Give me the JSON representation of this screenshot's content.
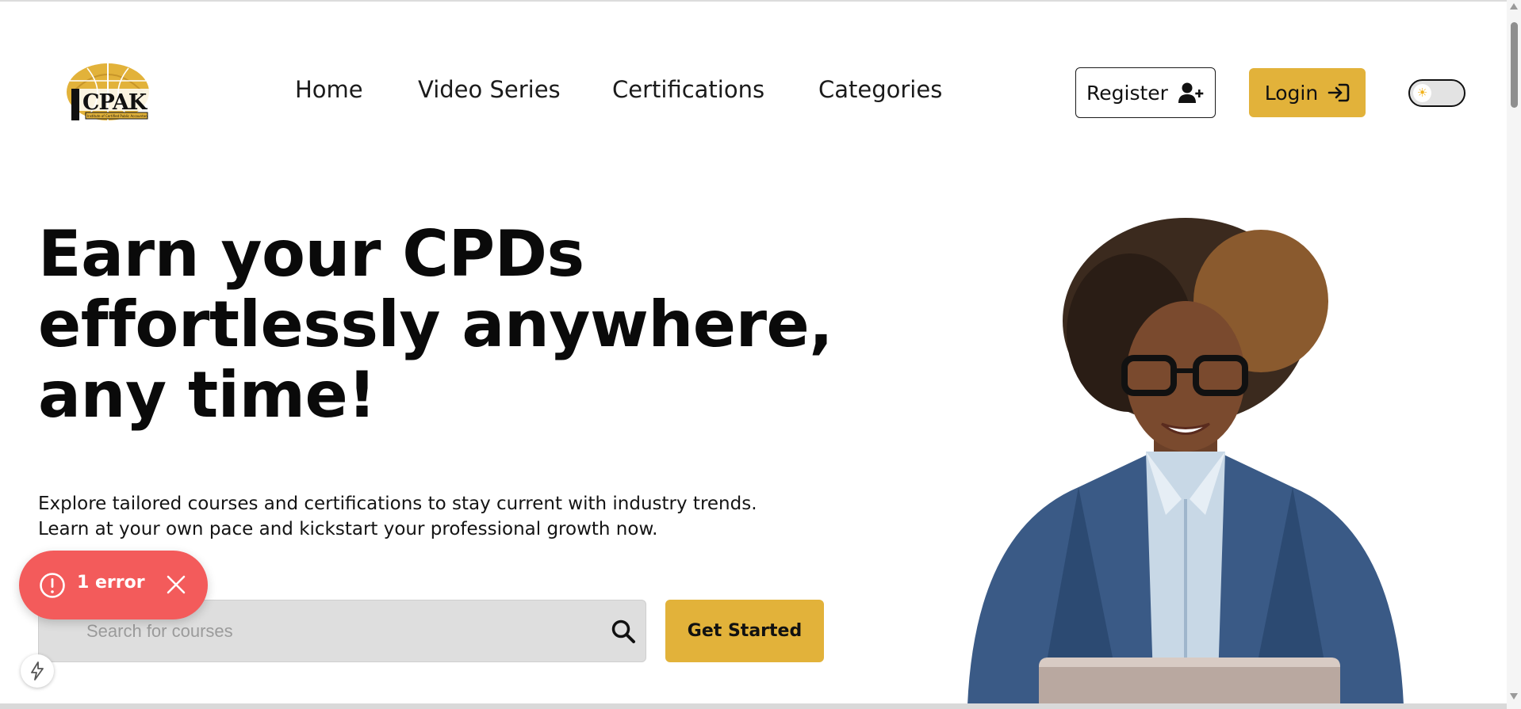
{
  "brand": {
    "logo_text": "CPAK",
    "logo_tagline": "Institute of Certified Public Accountants",
    "accent_color": "#e2b23a"
  },
  "nav": {
    "items": [
      {
        "label": "Home"
      },
      {
        "label": "Video Series"
      },
      {
        "label": "Certifications"
      },
      {
        "label": "Categories"
      }
    ]
  },
  "header_actions": {
    "register_label": "Register",
    "register_icon": "user-plus-icon",
    "login_label": "Login",
    "login_icon": "sign-in-icon",
    "theme_toggle_icon": "sun-icon",
    "theme_toggle_glyph": "☀"
  },
  "hero": {
    "title_line1": "Earn your CPDs",
    "title_line2": "effortlessly anywhere,",
    "title_line3": "any time!",
    "subtitle_line1": "Explore tailored courses and certifications to stay current with industry trends.",
    "subtitle_line2": "Learn at your own pace and kickstart your professional growth now.",
    "search_placeholder": "Search for courses",
    "search_icon": "search-icon",
    "cta_label": "Get Started"
  },
  "error_toast": {
    "label": "1 error",
    "color": "#f35b5b",
    "icon": "alert-circle-icon",
    "close_icon": "close-icon"
  },
  "dev_tools": {
    "icon": "lightning-bolt-icon"
  }
}
